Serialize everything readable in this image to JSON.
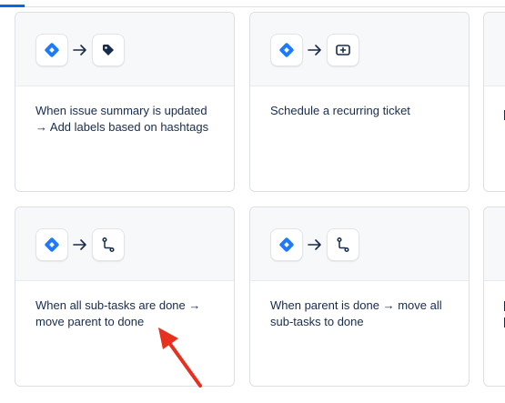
{
  "cards": [
    {
      "trigger_icon": "jira-diamond-icon",
      "action_icon": "tag-icon",
      "text": "When issue summary is updated → Add labels based on hashtags"
    },
    {
      "trigger_icon": "jira-diamond-icon",
      "action_icon": "create-ticket-icon",
      "text": "Schedule a recurring ticket"
    },
    {
      "trigger_icon": "jira-diamond-icon",
      "action_icon": "transition-icon",
      "text": "When all sub-tasks are done → move parent to done"
    },
    {
      "trigger_icon": "jira-diamond-icon",
      "action_icon": "transition-icon",
      "text": "When parent is done → move all sub-tasks to done"
    }
  ],
  "colors": {
    "jira_blue": "#1d7afc",
    "annotation_red": "#e8301f",
    "tab_indicator": "#0c66e4"
  }
}
